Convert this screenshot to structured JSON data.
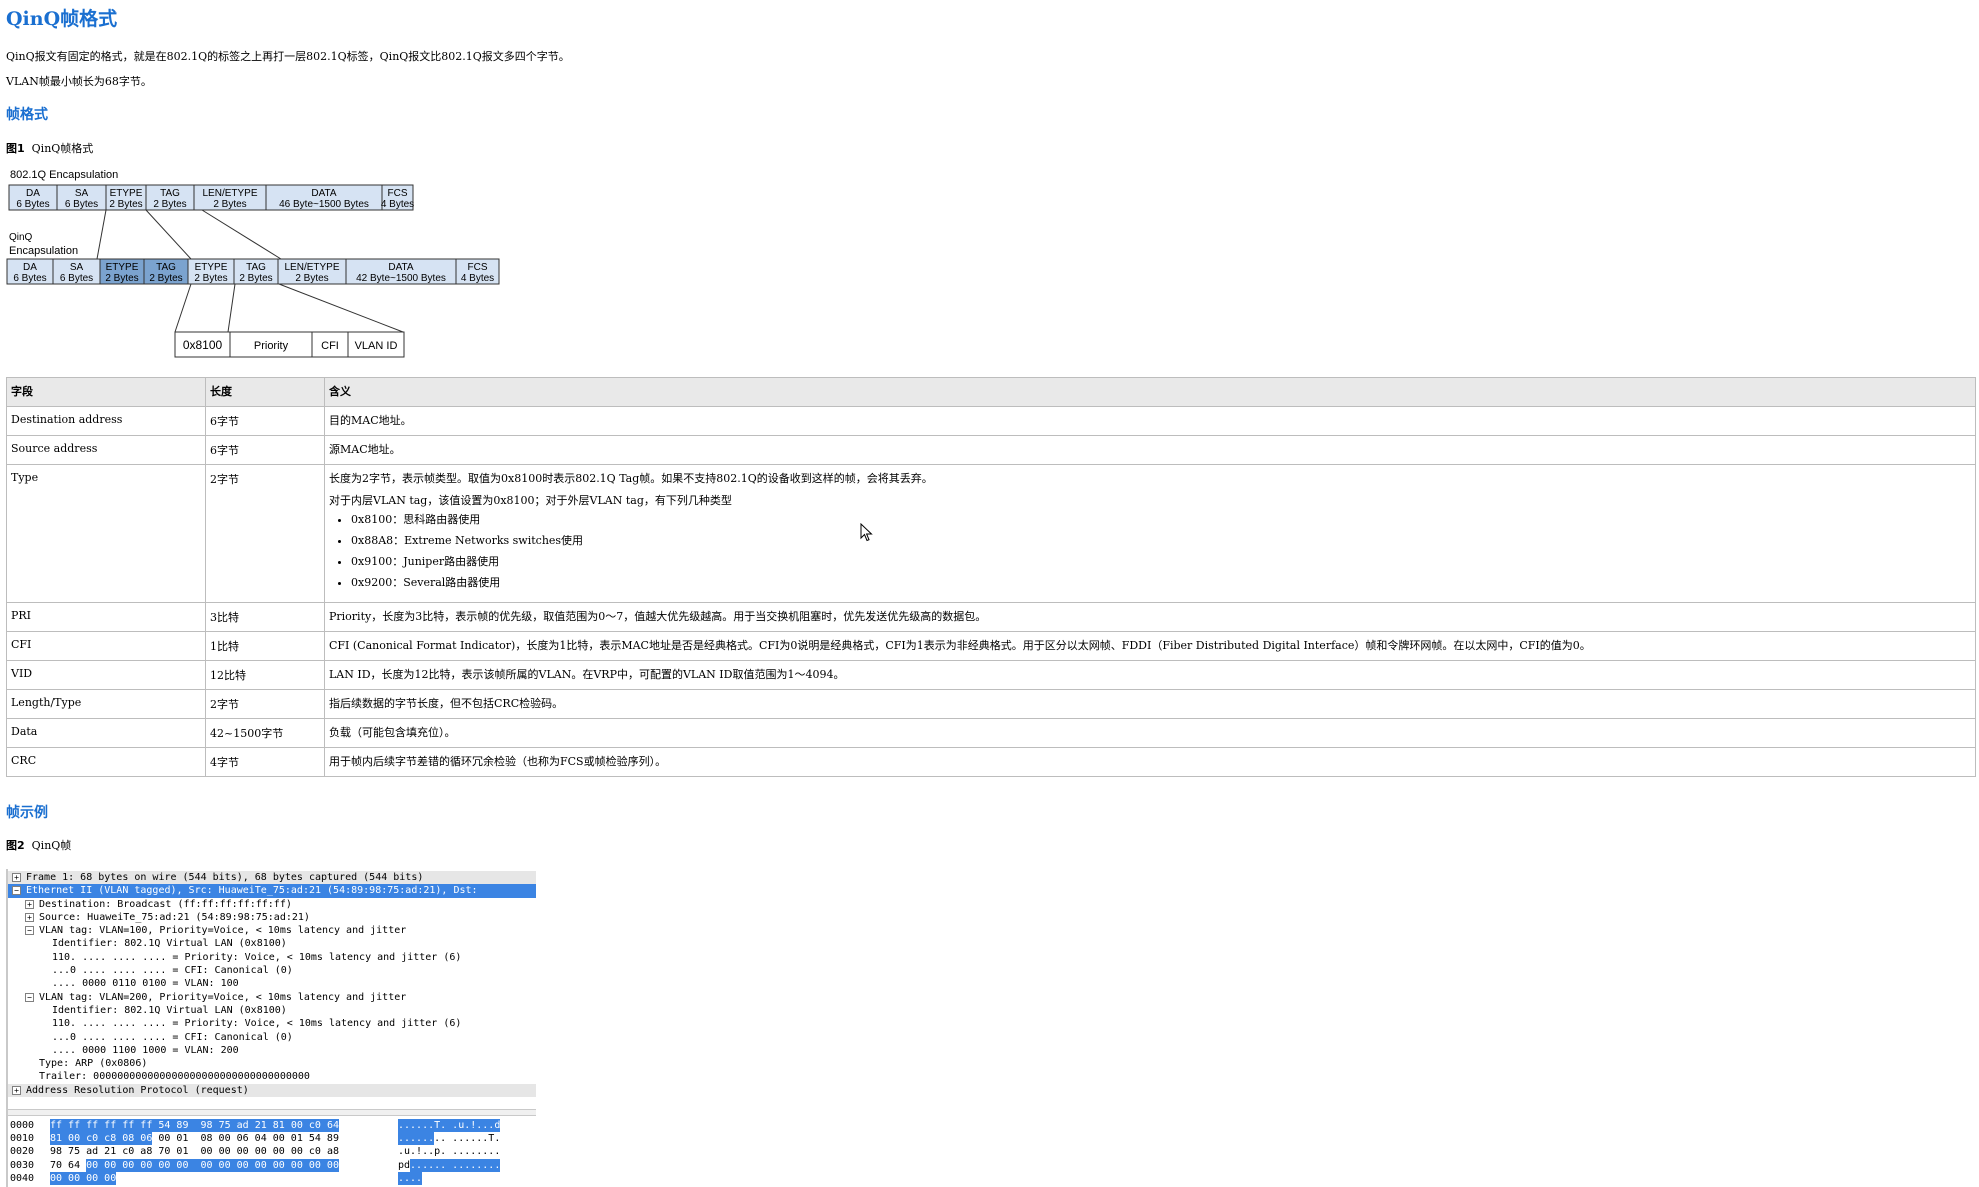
{
  "page": {
    "title": "QinQ帧格式",
    "intro": "QinQ报文有固定的格式，就是在802.1Q的标签之上再打一层802.1Q标签，QinQ报文比802.1Q报文多四个字节。",
    "min_frame": "VLAN帧最小帧长为68字节。",
    "section_format": "帧格式",
    "fig1_label": "图1",
    "fig1_caption": "QinQ帧格式",
    "section_example": "帧示例",
    "fig2_label": "图2",
    "fig2_caption": "QinQ帧"
  },
  "diagram": {
    "enc1_label": "802.1Q Encapsulation",
    "enc2_label_1": "QinQ",
    "enc2_label_2": "Encapsulation",
    "row1": [
      {
        "name": "DA",
        "size": "6 Bytes"
      },
      {
        "name": "SA",
        "size": "6 Bytes"
      },
      {
        "name": "ETYPE",
        "size": "2 Bytes"
      },
      {
        "name": "TAG",
        "size": "2 Bytes"
      },
      {
        "name": "LEN/ETYPE",
        "size": "2 Bytes"
      },
      {
        "name": "DATA",
        "size": "46 Byte~1500 Bytes"
      },
      {
        "name": "FCS",
        "size": "4 Bytes"
      }
    ],
    "row2": [
      {
        "name": "DA",
        "size": "6 Bytes"
      },
      {
        "name": "SA",
        "size": "6 Bytes"
      },
      {
        "name": "ETYPE",
        "size": "2 Bytes"
      },
      {
        "name": "TAG",
        "size": "2 Bytes"
      },
      {
        "name": "ETYPE",
        "size": "2 Bytes"
      },
      {
        "name": "TAG",
        "size": "2 Bytes"
      },
      {
        "name": "LEN/ETYPE",
        "size": "2 Bytes"
      },
      {
        "name": "DATA",
        "size": "42 Byte~1500 Bytes"
      },
      {
        "name": "FCS",
        "size": "4 Bytes"
      }
    ],
    "tag_detail": [
      "0x8100",
      "Priority",
      "CFI",
      "VLAN ID"
    ],
    "colors": {
      "light": "#d6e3f3",
      "dark": "#7ba3cf",
      "border": "#333333"
    }
  },
  "table": {
    "headers": [
      "字段",
      "长度",
      "含义"
    ],
    "rows": [
      {
        "field": "Destination address",
        "len": "6字节",
        "meaning": "目的MAC地址。"
      },
      {
        "field": "Source address",
        "len": "6字节",
        "meaning": "源MAC地址。"
      },
      {
        "field": "Type",
        "len": "2字节",
        "meaning": "长度为2字节，表示帧类型。取值为0x8100时表示802.1Q Tag帧。如果不支持802.1Q的设备收到这样的帧，会将其丢弃。",
        "meaning2": "对于内层VLAN tag，该值设置为0x8100；对于外层VLAN tag，有下列几种类型",
        "bullets": [
          "0x8100：思科路由器使用",
          "0x88A8：Extreme Networks switches使用",
          "0x9100：Juniper路由器使用",
          "0x9200：Several路由器使用"
        ]
      },
      {
        "field": "PRI",
        "len": "3比特",
        "meaning": "Priority，长度为3比特，表示帧的优先级，取值范围为0～7，值越大优先级越高。用于当交换机阻塞时，优先发送优先级高的数据包。"
      },
      {
        "field": "CFI",
        "len": "1比特",
        "meaning": "CFI (Canonical Format Indicator)，长度为1比特，表示MAC地址是否是经典格式。CFI为0说明是经典格式，CFI为1表示为非经典格式。用于区分以太网帧、FDDI（Fiber Distributed Digital Interface）帧和令牌环网帧。在以太网中，CFI的值为0。"
      },
      {
        "field": "VID",
        "len": "12比特",
        "meaning": "LAN ID，长度为12比特，表示该帧所属的VLAN。在VRP中，可配置的VLAN ID取值范围为1～4094。"
      },
      {
        "field": "Length/Type",
        "len": "2字节",
        "meaning": "指后续数据的字节长度，但不包括CRC检验码。"
      },
      {
        "field": "Data",
        "len": "42~1500字节",
        "meaning": "负载（可能包含填充位）。"
      },
      {
        "field": "CRC",
        "len": "4字节",
        "meaning": "用于帧内后续字节差错的循环冗余检验（也称为FCS或帧检验序列）。"
      }
    ]
  },
  "capture": {
    "tree": [
      {
        "text": "Frame 1: 68 bytes on wire (544 bits), 68 bytes captured (544 bits)",
        "toggle": "+",
        "level": 0,
        "style": "gray"
      },
      {
        "text": "Ethernet II (VLAN tagged), Src: HuaweiTe_75:ad:21 (54:89:98:75:ad:21), Dst:",
        "toggle": "−",
        "level": 0,
        "style": "sel"
      },
      {
        "text": "Destination: Broadcast (ff:ff:ff:ff:ff:ff)",
        "toggle": "+",
        "level": 1,
        "style": ""
      },
      {
        "text": "Source: HuaweiTe_75:ad:21 (54:89:98:75:ad:21)",
        "toggle": "+",
        "level": 1,
        "style": ""
      },
      {
        "text": "VLAN tag: VLAN=100, Priority=Voice, < 10ms latency and jitter",
        "toggle": "−",
        "level": 1,
        "style": ""
      },
      {
        "text": "Identifier: 802.1Q Virtual LAN (0x8100)",
        "toggle": "",
        "level": 2,
        "style": ""
      },
      {
        "text": "110. .... .... .... = Priority: Voice, < 10ms latency and jitter (6)",
        "toggle": "",
        "level": 2,
        "style": ""
      },
      {
        "text": "...0 .... .... .... = CFI: Canonical (0)",
        "toggle": "",
        "level": 2,
        "style": ""
      },
      {
        "text": ".... 0000 0110 0100 = VLAN: 100",
        "toggle": "",
        "level": 2,
        "style": ""
      },
      {
        "text": "VLAN tag: VLAN=200, Priority=Voice, < 10ms latency and jitter",
        "toggle": "−",
        "level": 1,
        "style": ""
      },
      {
        "text": "Identifier: 802.1Q Virtual LAN (0x8100)",
        "toggle": "",
        "level": 2,
        "style": ""
      },
      {
        "text": "110. .... .... .... = Priority: Voice, < 10ms latency and jitter (6)",
        "toggle": "",
        "level": 2,
        "style": ""
      },
      {
        "text": "...0 .... .... .... = CFI: Canonical (0)",
        "toggle": "",
        "level": 2,
        "style": ""
      },
      {
        "text": ".... 0000 1100 1000 = VLAN: 200",
        "toggle": "",
        "level": 2,
        "style": ""
      },
      {
        "text": "Type: ARP (0x0806)",
        "toggle": "",
        "level": 1,
        "style": ""
      },
      {
        "text": "Trailer: 000000000000000000000000000000000000",
        "toggle": "",
        "level": 1,
        "style": ""
      },
      {
        "text": "Address Resolution Protocol (request)",
        "toggle": "+",
        "level": 0,
        "style": "gray"
      }
    ],
    "hex": [
      {
        "off": "0000",
        "plain": "",
        "hl": "ff ff ff ff ff ff 54 89  98 75 ad 21 81 00 c0 64",
        "after": "",
        "ascii_hl": "......T. .u.!...d",
        "ascii_plain": ""
      },
      {
        "off": "0010",
        "plain": "",
        "hl": "81 00 c0 c8 08 06",
        "after": " 00 01  08 00 06 04 00 01 54 89",
        "ascii_hl": "......",
        "ascii_plain": ".. ......T."
      },
      {
        "off": "0020",
        "plain": "98 75 ad 21 c0 a8 70 01  00 00 00 00 00 00 c0 a8",
        "hl": "",
        "after": "",
        "ascii_hl": "",
        "ascii_plain": ".u.!..p. ........"
      },
      {
        "off": "0030",
        "plain": "70 64 ",
        "hl": "00 00 00 00 00 00  00 00 00 00 00 00 00 00",
        "after": "",
        "ascii_hl": "...... ........",
        "ascii_plain": "pd"
      },
      {
        "off": "0040",
        "plain": "",
        "hl": "00 00 00 00",
        "after": "",
        "ascii_hl": "....",
        "ascii_plain": ""
      }
    ]
  }
}
